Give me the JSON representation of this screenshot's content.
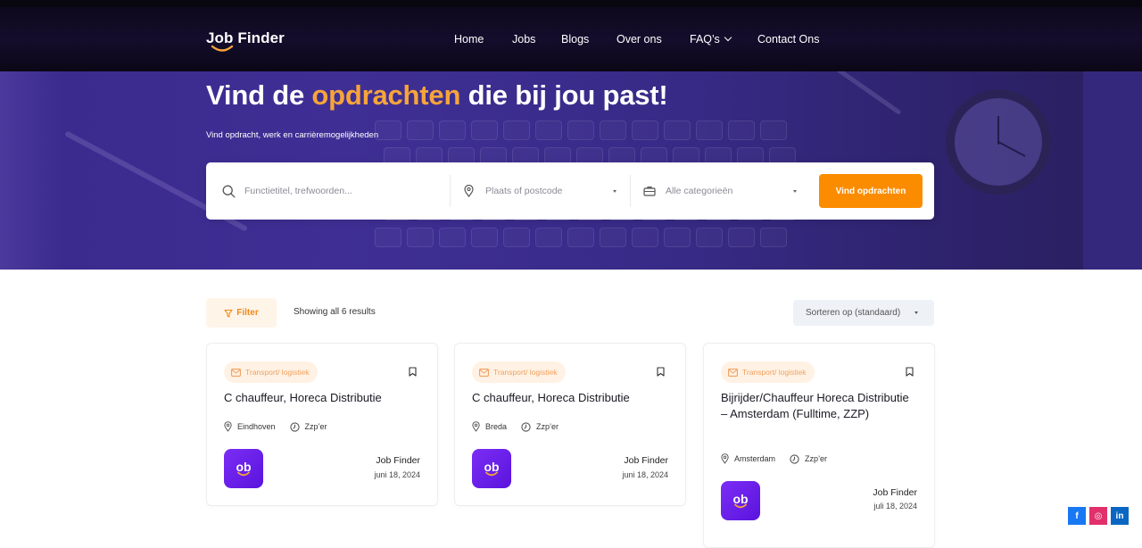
{
  "header": {
    "logo_text": "Job Finder",
    "nav": [
      {
        "label": "Home"
      },
      {
        "label": "Jobs"
      },
      {
        "label": "Blogs"
      },
      {
        "label": "Over ons"
      },
      {
        "label": "FAQ’s"
      },
      {
        "label": "Contact Ons"
      }
    ]
  },
  "hero": {
    "title_before": "Vind de ",
    "title_accent": "opdrachten",
    "title_after": " die bij jou past!",
    "subtitle": "Vind opdracht, werk en carrièremogelijkheden"
  },
  "search": {
    "keyword_placeholder": "Functietitel, trefwoorden...",
    "location_placeholder": "Plaats of postcode",
    "category_value": "Alle categorieën",
    "submit_label": "Vind opdrachten"
  },
  "toolbar": {
    "filter_label": "Filter",
    "results_text": "Showing all 6 results",
    "sort_label": "Sorteren op (standaard)"
  },
  "jobs": [
    {
      "category": "Transport/ logistiek",
      "title": "C chauffeur, Horeca Distributie",
      "location": "Eindhoven",
      "type": "Zzp’er",
      "company": "Job Finder",
      "date": "juni 18, 2024",
      "logo_text": "ob"
    },
    {
      "category": "Transport/ logistiek",
      "title": "C chauffeur, Horeca Distributie",
      "location": "Breda",
      "type": "Zzp’er",
      "company": "Job Finder",
      "date": "juni 18, 2024",
      "logo_text": "ob"
    },
    {
      "category": "Transport/ logistiek",
      "title": "Bijrijder/Chauffeur Horeca Distributie – Amsterdam (Fulltime, ZZP)",
      "location": "Amsterdam",
      "type": "Zzp’er",
      "company": "Job Finder",
      "date": "juli 18, 2024",
      "logo_text": "ob"
    }
  ],
  "social": [
    {
      "name": "facebook-icon",
      "glyph": "f",
      "color": "#1877f2"
    },
    {
      "name": "instagram-icon",
      "glyph": "◎",
      "color": "#e1306c"
    },
    {
      "name": "linkedin-icon",
      "glyph": "in",
      "color": "#0a66c2"
    }
  ],
  "colors": {
    "accent": "#fb8c00",
    "brand_purple": "#6a1ff0",
    "hero_bg": "#3a2a8c"
  }
}
